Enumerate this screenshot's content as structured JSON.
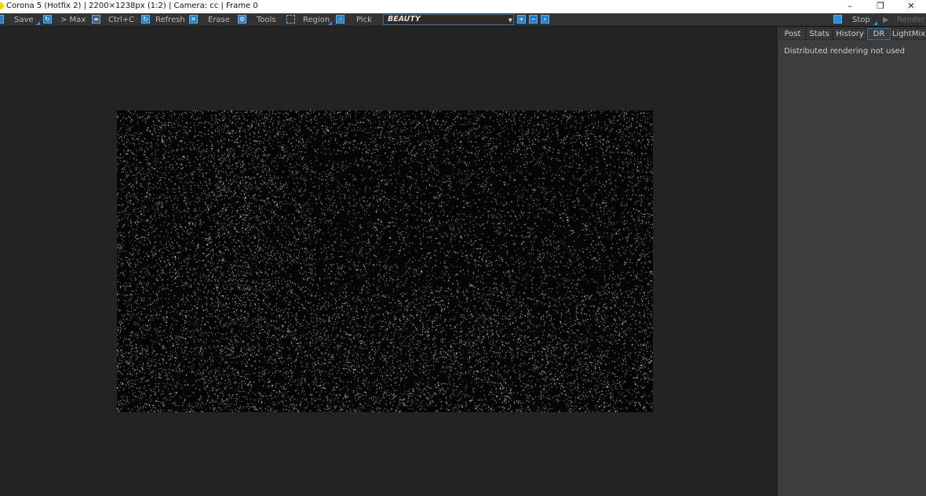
{
  "window": {
    "title": "Corona 5 (Hotfix 2) | 2200×1238px (1:2) | Camera: cc | Frame 0",
    "minimize": "–",
    "restore": "❐",
    "close": "✕"
  },
  "toolbar": {
    "save": "Save",
    "max": "> Max",
    "copy": "Ctrl+C",
    "refresh": "Refresh",
    "erase": "Erase",
    "tools": "Tools",
    "region": "Region",
    "pick": "Pick",
    "pass": "BEAUTY",
    "stop": "Stop",
    "render": "Render"
  },
  "panel": {
    "tabs": [
      "Post",
      "Stats",
      "History",
      "DR",
      "LightMix"
    ],
    "active_tab": "DR",
    "message": "Distributed rendering not used"
  },
  "colors": {
    "accent": "#2e8be0",
    "background": "#232323",
    "panel": "#3d3d3d"
  }
}
